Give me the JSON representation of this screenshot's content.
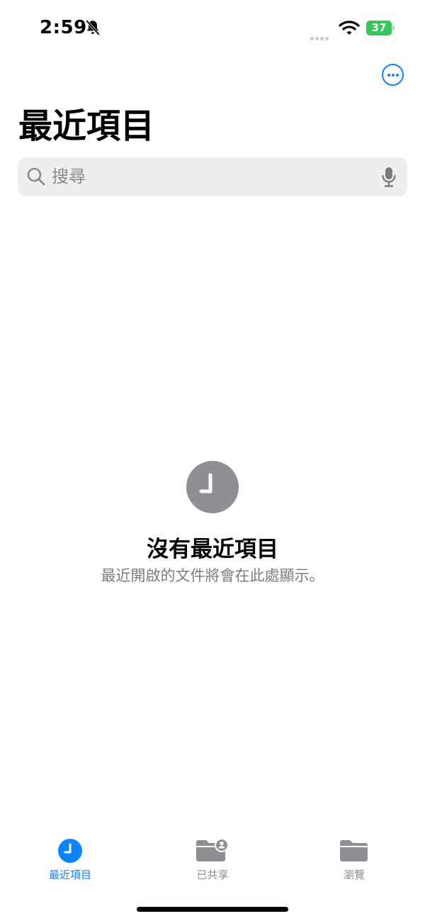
{
  "status_bar": {
    "time": "2:59",
    "battery_level": "37",
    "battery_color": "#34c759",
    "icons": [
      "bell-slash-icon",
      "cellular-signal-icon",
      "wifi-icon",
      "battery-charging-icon"
    ]
  },
  "nav": {
    "more_icon": "ellipsis-circle-icon",
    "title": "最近項目"
  },
  "search": {
    "placeholder": "搜尋",
    "left_icon": "magnifying-glass-icon",
    "right_icon": "microphone-icon"
  },
  "empty_state": {
    "icon": "clock-icon",
    "title": "沒有最近項目",
    "subtitle": "最近開啟的文件將會在此處顯示。"
  },
  "tab_bar": {
    "accent_color": "#0a84ff",
    "inactive_color": "#8e8e93",
    "tabs": [
      {
        "label": "最近項目",
        "icon": "clock-icon",
        "active": true
      },
      {
        "label": "已共享",
        "icon": "shared-folder-icon",
        "active": false
      },
      {
        "label": "瀏覽",
        "icon": "folder-icon",
        "active": false
      }
    ]
  }
}
